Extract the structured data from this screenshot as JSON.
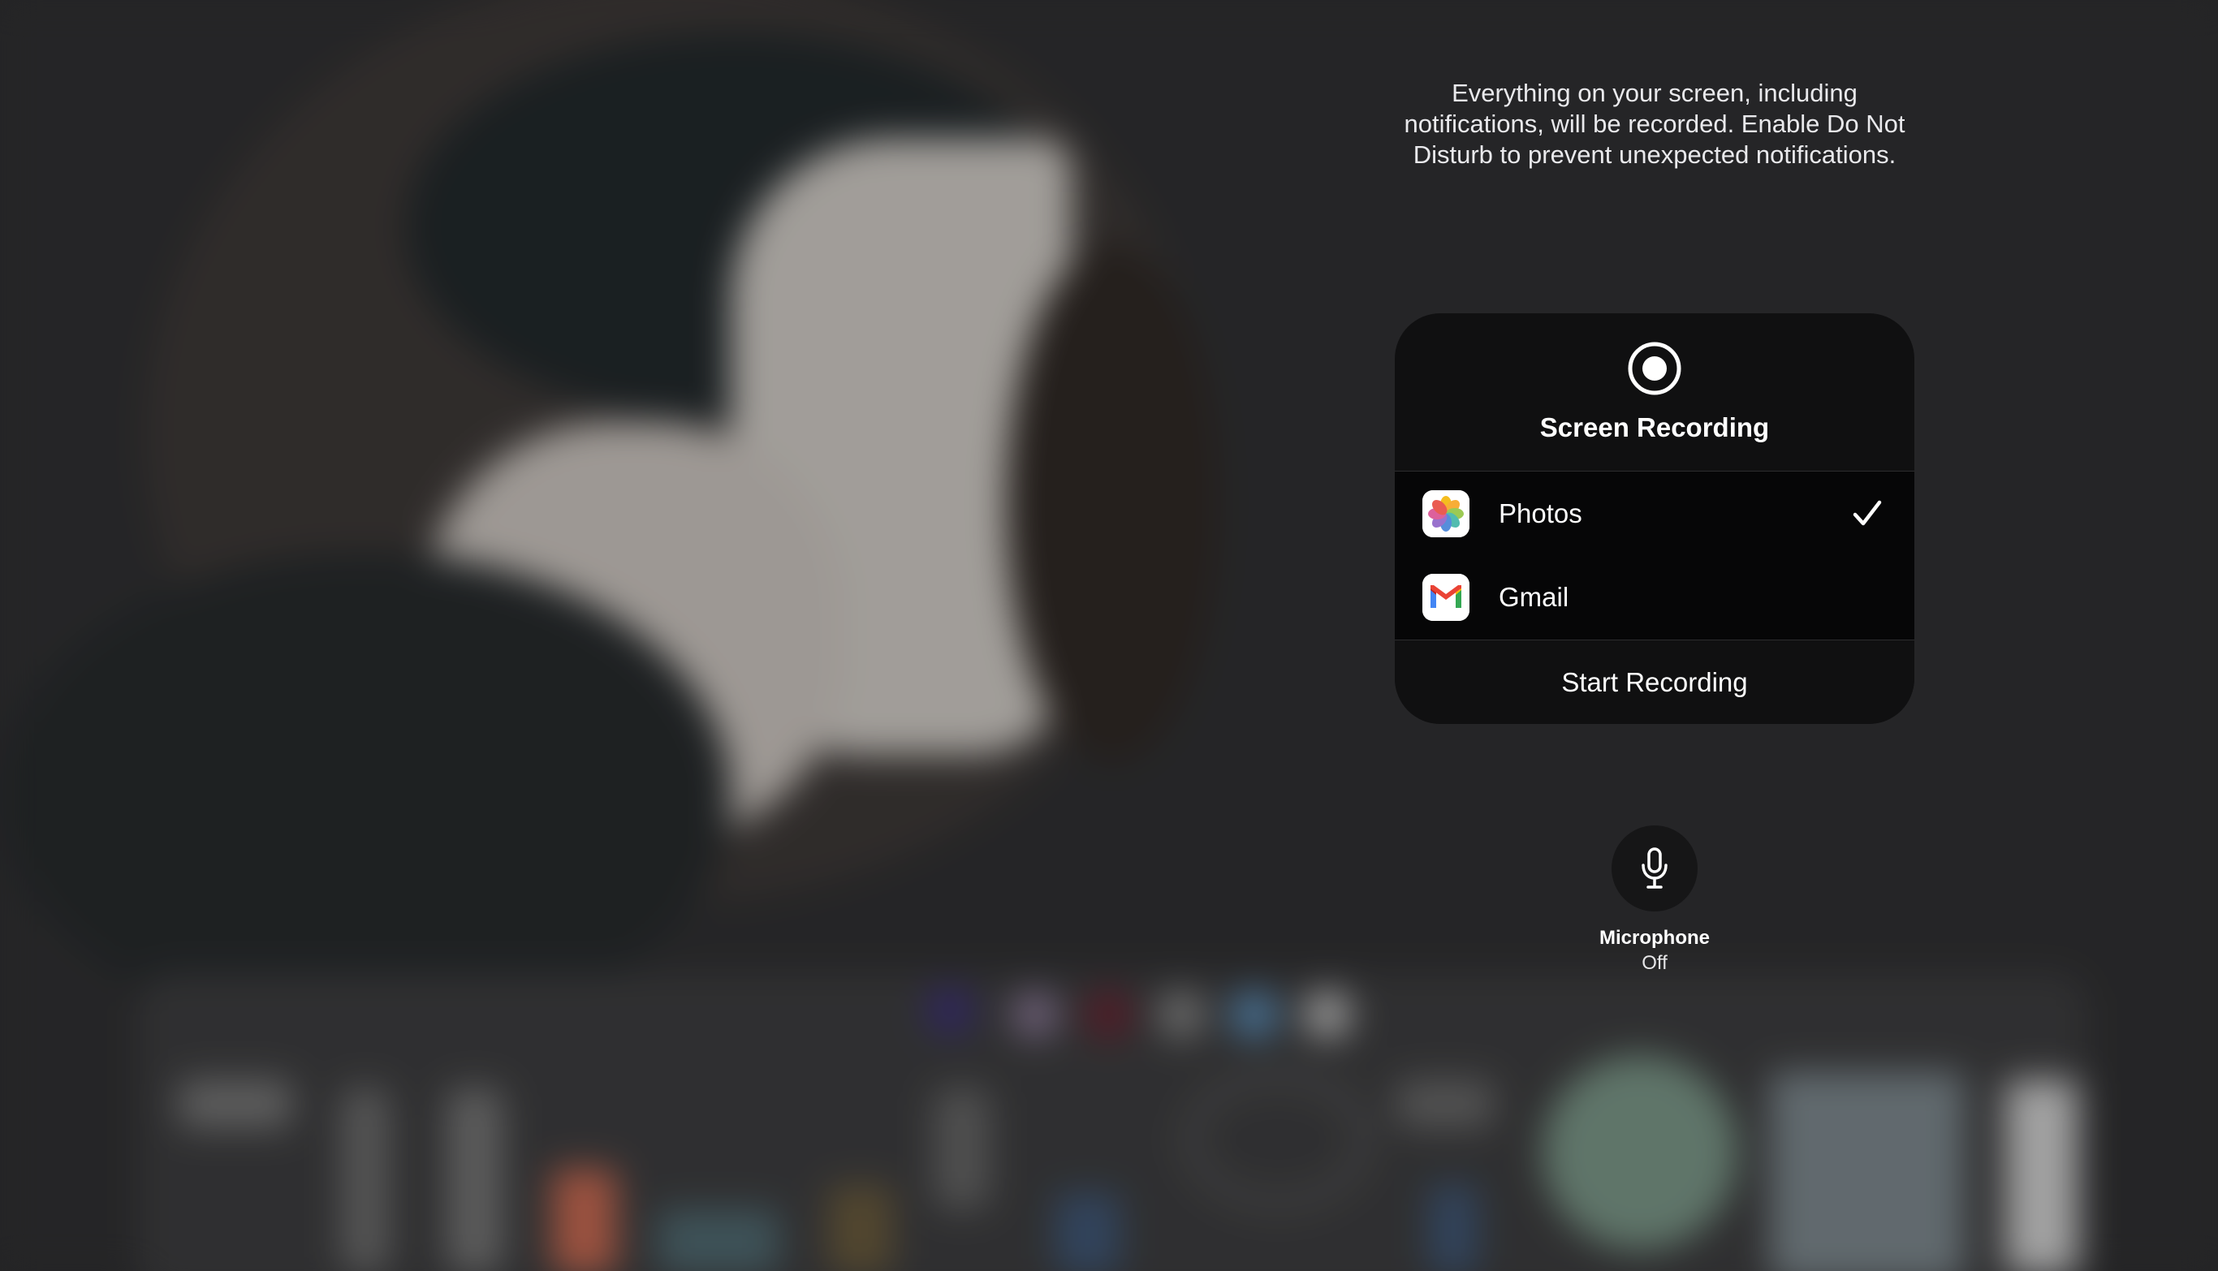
{
  "notice": {
    "text": "Everything on your screen, including notifications, will be recorded. Enable Do Not Disturb to prevent unexpected notifications."
  },
  "panel": {
    "icon": "record-icon",
    "title": "Screen Recording",
    "apps": [
      {
        "label": "Photos",
        "icon": "photos-app-icon",
        "selected": true
      },
      {
        "label": "Gmail",
        "icon": "gmail-app-icon",
        "selected": false
      }
    ],
    "start_button_label": "Start Recording"
  },
  "microphone": {
    "icon": "microphone-icon",
    "label": "Microphone",
    "state": "Off"
  },
  "colors": {
    "panel_background": "#101011",
    "row_background": "#060607",
    "text": "#ffffff"
  }
}
